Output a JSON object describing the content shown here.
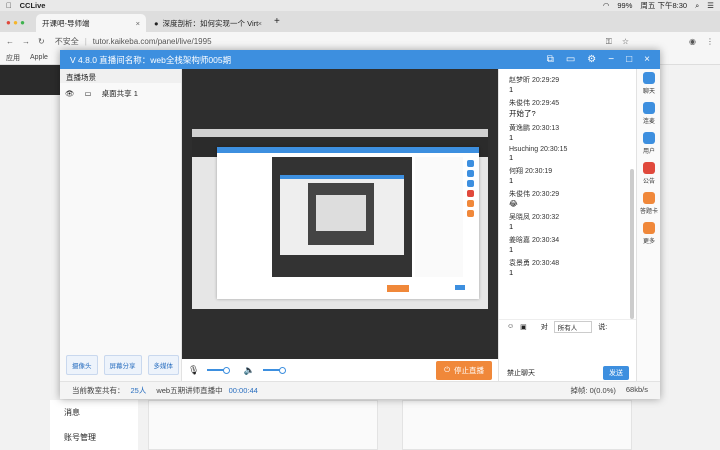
{
  "menubar": {
    "app": "CCLive",
    "battery": "99%",
    "datetime": "周五 下午8:30"
  },
  "tabs": [
    {
      "label": "开课吧-导师端"
    },
    {
      "label": "深度剖析：如何实现一个 Virtu..."
    }
  ],
  "address": {
    "security": "不安全",
    "url": "tutor.kaikeba.com/panel/live/1995"
  },
  "bookmarks": {
    "apps": "应用",
    "apple": "Apple"
  },
  "background": {
    "nav_item_1": "消息",
    "nav_item_2": "账号管理"
  },
  "window": {
    "title": "V 4.8.0  直播间名称：web全栈架构师005期"
  },
  "left_panel": {
    "heading": "直播场景",
    "scene": "桌面共享 1",
    "buttons": [
      "摄像头",
      "屏幕分享",
      "多媒体"
    ]
  },
  "controls": {
    "stop_label": "停止直播"
  },
  "status": {
    "online_label": "当前教室共有：",
    "online_count": "25人",
    "live_label": "web五期讲师直播中",
    "timer": "00:00:44",
    "loss": "掉帧: 0(0.0%)",
    "rate": "68kb/s"
  },
  "chat": {
    "messages": [
      {
        "who": "赵梦昕 20:29:29",
        "text": "1"
      },
      {
        "who": "朱俊伟 20:29:45",
        "text": "开始了?"
      },
      {
        "who": "黄逸鹏 20:30:13",
        "text": "1"
      },
      {
        "who": "Hsuching 20:30:15",
        "text": "1"
      },
      {
        "who": "何翔 20:30:19",
        "text": "1"
      },
      {
        "who": "朱俊伟 20:30:29",
        "text": "😂"
      },
      {
        "who": "吴晓凤 20:30:32",
        "text": "1"
      },
      {
        "who": "姜晗嘉 20:30:34",
        "text": "1"
      },
      {
        "who": "袁景勇 20:30:48",
        "text": "1"
      }
    ],
    "to_label": "对",
    "to_value": "所有人",
    "say_label": "说:",
    "mute_label": "禁止聊天",
    "send_label": "发送"
  },
  "side_icons": [
    {
      "label": "聊天",
      "color": "#3d8fdf"
    },
    {
      "label": "连麦",
      "color": "#3d8fdf"
    },
    {
      "label": "用户",
      "color": "#3d8fdf"
    },
    {
      "label": "公告",
      "color": "#e0493c"
    },
    {
      "label": "答题卡",
      "color": "#f0883a"
    },
    {
      "label": "更多",
      "color": "#f0883a"
    }
  ]
}
